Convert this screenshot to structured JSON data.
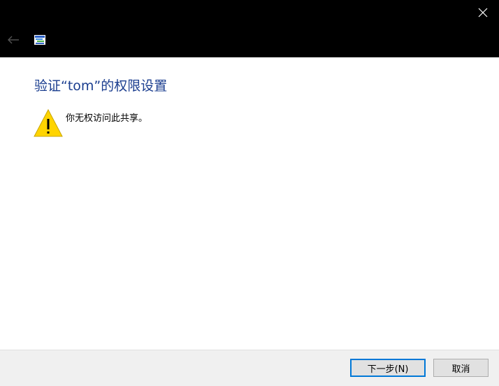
{
  "titlebar": {
    "close_icon": "close-icon",
    "back_icon": "back-arrow-icon",
    "app_icon": "network-share-icon"
  },
  "main": {
    "heading": "验证“tom”的权限设置",
    "warning_icon": "warning-icon",
    "message": "你无权访问此共享。"
  },
  "footer": {
    "next_label": "下一步(N)",
    "cancel_label": "取消"
  },
  "colors": {
    "titlebar_bg": "#000000",
    "heading": "#1a3d8f",
    "footer_bg": "#f0f0f0",
    "default_button_border": "#0078d7",
    "warning_fill": "#ffd400"
  }
}
